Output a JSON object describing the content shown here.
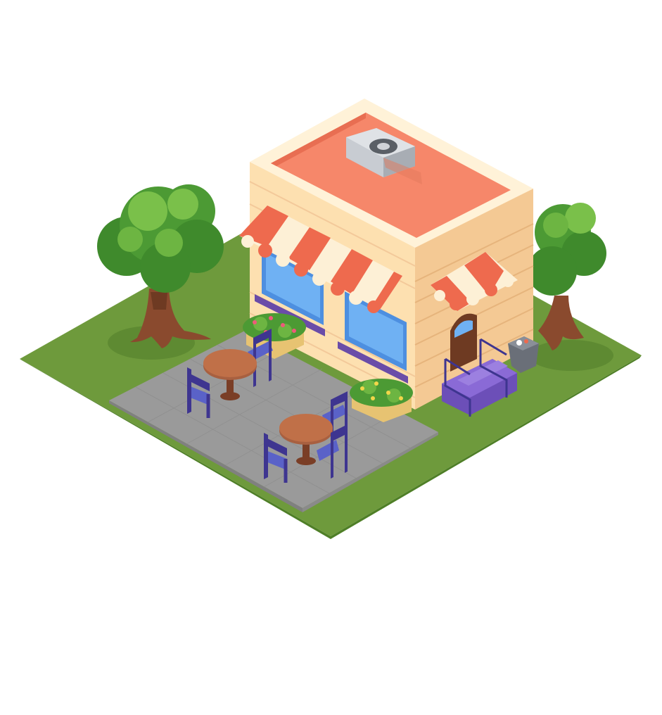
{
  "scene": {
    "kind": "isometric cafe building tile",
    "background": "#ffffff",
    "colors": {
      "grass": "#6e9a3c",
      "grass_dark": "#5a8a2e",
      "patio": "#9a9a9a",
      "roof": "#f6876a",
      "roof_rim": "#fff2d8",
      "wall": "#fde0b0",
      "wall_shade": "#f4c994",
      "awning_red": "#ee6a4e",
      "awning_cream": "#fdf0d6",
      "window": "#5aa2ee",
      "chair": "#4a4ea6",
      "table": "#a86040",
      "tree_leaf": "#5aa23a",
      "trunk": "#8a4a2e",
      "stairs": "#7a5cc8"
    },
    "objects": [
      "tree-icon",
      "tree-icon",
      "cafe-building",
      "awning-icon",
      "awning-icon",
      "air-conditioner-icon",
      "door-icon",
      "stairs-icon",
      "trash-bin-icon",
      "flower-box-icon",
      "flower-box-icon",
      "table-icon",
      "table-icon",
      "chair-icon"
    ]
  }
}
